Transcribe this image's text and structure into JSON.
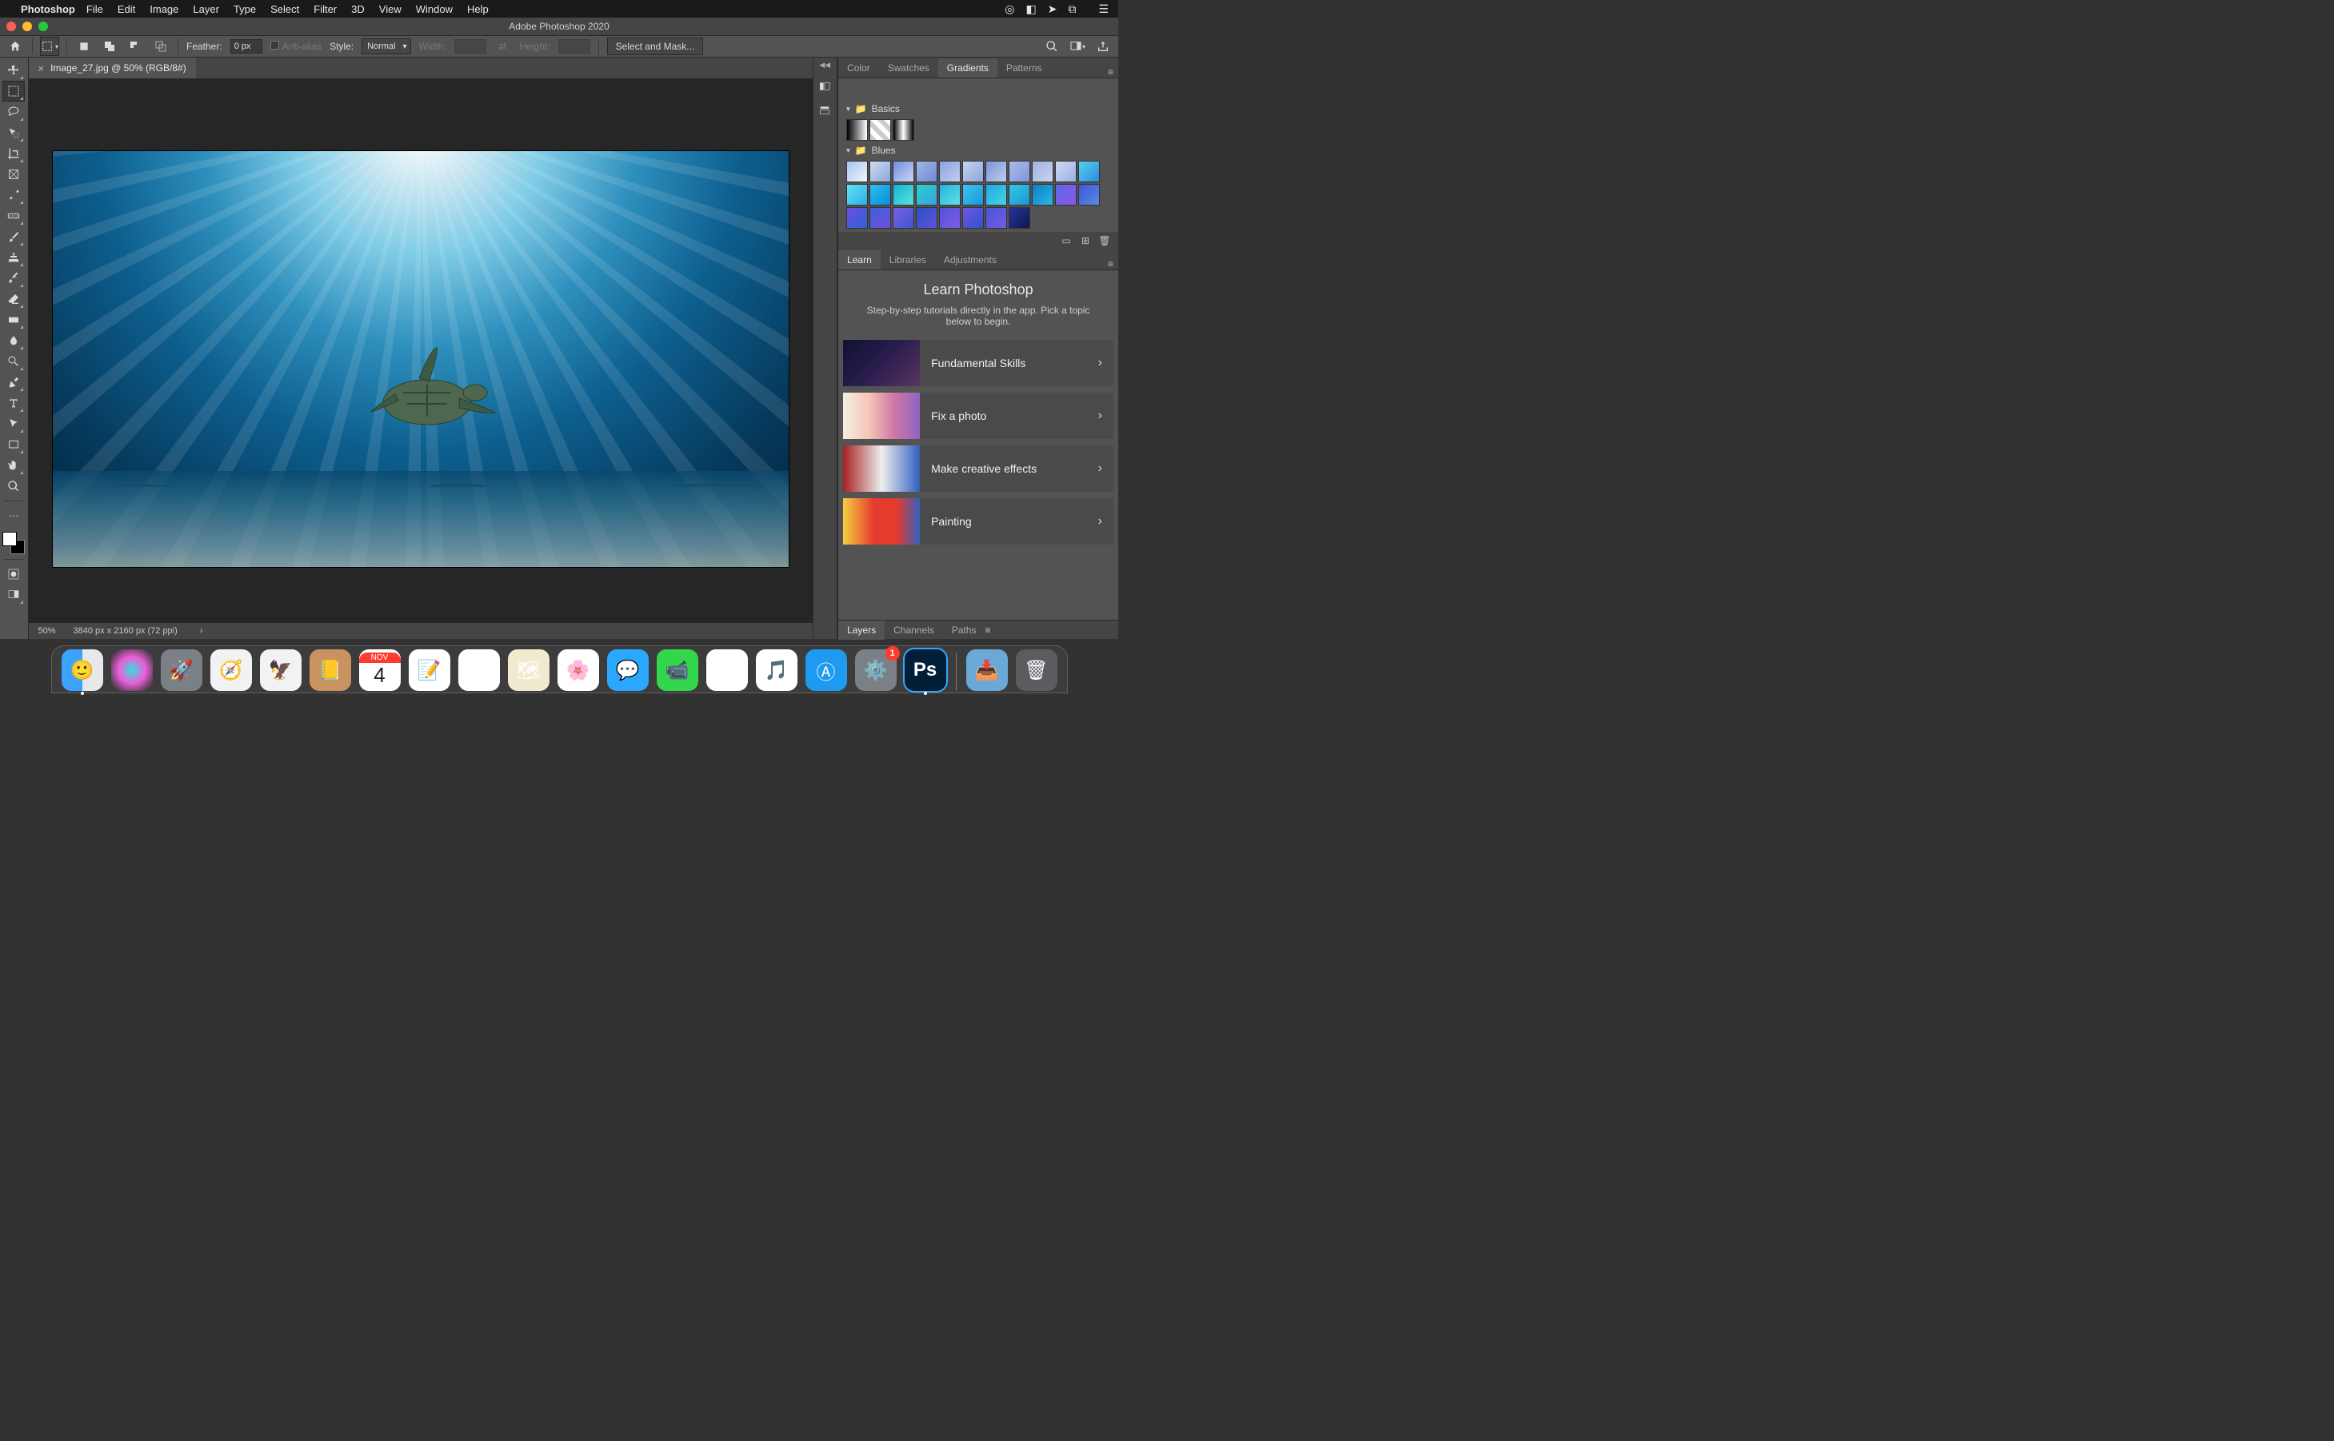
{
  "menubar": {
    "app": "Photoshop",
    "items": [
      "File",
      "Edit",
      "Image",
      "Layer",
      "Type",
      "Select",
      "Filter",
      "3D",
      "View",
      "Window",
      "Help"
    ]
  },
  "window": {
    "title": "Adobe Photoshop 2020"
  },
  "optionsbar": {
    "feather_label": "Feather:",
    "feather_value": "0 px",
    "antialias_label": "Anti-alias",
    "style_label": "Style:",
    "style_value": "Normal",
    "width_label": "Width:",
    "height_label": "Height:",
    "mask_button": "Select and Mask..."
  },
  "document": {
    "tab_label": "Image_27.jpg @ 50% (RGB/8#)",
    "zoom": "50%",
    "dimensions": "3840 px x 2160 px (72 ppi)"
  },
  "tools": [
    {
      "name": "move-tool"
    },
    {
      "name": "marquee-tool",
      "active": true
    },
    {
      "name": "lasso-tool"
    },
    {
      "name": "quick-select-tool"
    },
    {
      "name": "crop-tool"
    },
    {
      "name": "frame-tool"
    },
    {
      "name": "eyedropper-tool"
    },
    {
      "name": "healing-tool"
    },
    {
      "name": "brush-tool"
    },
    {
      "name": "clone-stamp-tool"
    },
    {
      "name": "history-brush-tool"
    },
    {
      "name": "eraser-tool"
    },
    {
      "name": "gradient-tool"
    },
    {
      "name": "blur-tool"
    },
    {
      "name": "dodge-tool"
    },
    {
      "name": "pen-tool"
    },
    {
      "name": "type-tool"
    },
    {
      "name": "path-select-tool"
    },
    {
      "name": "shape-tool"
    },
    {
      "name": "hand-tool"
    },
    {
      "name": "zoom-tool"
    }
  ],
  "panel_group_top": {
    "tabs": [
      "Color",
      "Swatches",
      "Gradients",
      "Patterns"
    ],
    "active": 2
  },
  "gradients": {
    "groups": {
      "basics": {
        "label": "Basics",
        "swatches": [
          "linear-gradient(90deg,#000,#fff)",
          "repeating-linear-gradient(45deg,#ccc 0 6px,#fff 6px 12px)",
          "linear-gradient(90deg,#000,#fff,#000)"
        ]
      },
      "blues": {
        "label": "Blues",
        "swatches": [
          "linear-gradient(135deg,#a6c4ec,#f2f6fc)",
          "linear-gradient(135deg,#cfdcf2,#8aa6dc)",
          "linear-gradient(135deg,#6f8de0,#cbd7f4)",
          "linear-gradient(135deg,#9fb7e6,#6d88d4)",
          "linear-gradient(135deg,#8aa3e0,#c1cfee)",
          "linear-gradient(135deg,#c6d3ee,#8ea5de)",
          "linear-gradient(135deg,#7a94da,#bccded)",
          "linear-gradient(135deg,#a9bce6,#7f97db)",
          "linear-gradient(135deg,#9eb2e2,#c9d5ef)",
          "linear-gradient(135deg,#cdd9f1,#9cb1e2)",
          "linear-gradient(135deg,#56d1e8,#2a8be6)",
          "linear-gradient(135deg,#63e1f3,#2bb0e8)",
          "linear-gradient(135deg,#2dc0ee,#0a8cd6)",
          "linear-gradient(135deg,#12b6d6,#5be2d9)",
          "linear-gradient(135deg,#28d3c3,#3a9fe4)",
          "linear-gradient(135deg,#1fb4e3,#63e0e2)",
          "linear-gradient(135deg,#3ac4ee,#1898db)",
          "linear-gradient(135deg,#1fa8e3,#45d6e4)",
          "linear-gradient(135deg,#34c7e6,#1897d6)",
          "linear-gradient(135deg,#0f7ec8,#2bb6e4)",
          "linear-gradient(135deg,#5a6ae8,#8d55e6)",
          "linear-gradient(135deg,#3c56dc,#5a8ae0)",
          "linear-gradient(135deg,#6a4fe1,#2e62d6)",
          "linear-gradient(135deg,#4060d6,#6e50e0)",
          "linear-gradient(135deg,#7e5ce4,#3a58d2)",
          "linear-gradient(135deg,#2f4dc6,#5c54dc)",
          "linear-gradient(135deg,#5450d8,#7a60e4)",
          "linear-gradient(135deg,#6a58e0,#3650cc)",
          "linear-gradient(135deg,#4a55d6,#6f5de2)",
          "linear-gradient(135deg,#28349c,#0d1850)"
        ]
      }
    }
  },
  "panel_group_mid": {
    "tabs": [
      "Learn",
      "Libraries",
      "Adjustments"
    ],
    "active": 0
  },
  "learn": {
    "title": "Learn Photoshop",
    "subtitle": "Step-by-step tutorials directly in the app. Pick a topic below to begin.",
    "lessons": [
      {
        "label": "Fundamental Skills"
      },
      {
        "label": "Fix a photo"
      },
      {
        "label": "Make creative effects"
      },
      {
        "label": "Painting"
      }
    ]
  },
  "panel_group_bottom": {
    "tabs": [
      "Layers",
      "Channels",
      "Paths"
    ],
    "active": 0
  },
  "dock": {
    "calendar_month": "NOV",
    "calendar_day": "4",
    "ps_abbr": "Ps",
    "badge_settings": "1"
  }
}
